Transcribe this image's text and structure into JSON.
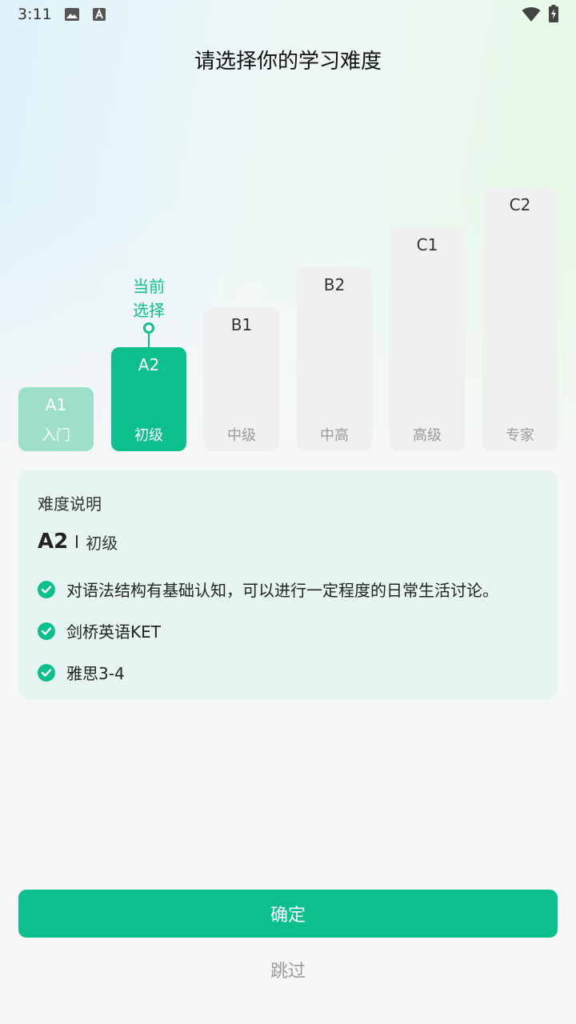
{
  "status_bar": {
    "time": "3:11"
  },
  "title": "请选择你的学习难度",
  "levels": [
    {
      "code": "A1",
      "name": "入门"
    },
    {
      "code": "A2",
      "name": "初级"
    },
    {
      "code": "B1",
      "name": "中级"
    },
    {
      "code": "B2",
      "name": "中高"
    },
    {
      "code": "C1",
      "name": "高级"
    },
    {
      "code": "C2",
      "name": "专家"
    }
  ],
  "current_marker": {
    "line1": "当前",
    "line2": "选择"
  },
  "description": {
    "title": "难度说明",
    "level_code": "A2",
    "level_name": "初级",
    "items": [
      "对语法结构有基础认知，可以进行一定程度的日常生活讨论。",
      "剑桥英语KET",
      "雅思3-4"
    ]
  },
  "buttons": {
    "confirm": "确定",
    "skip": "跳过"
  },
  "colors": {
    "accent": "#0dbf8c",
    "accent_light": "#9ddfc8",
    "card_bg": "#e6f5f1"
  }
}
